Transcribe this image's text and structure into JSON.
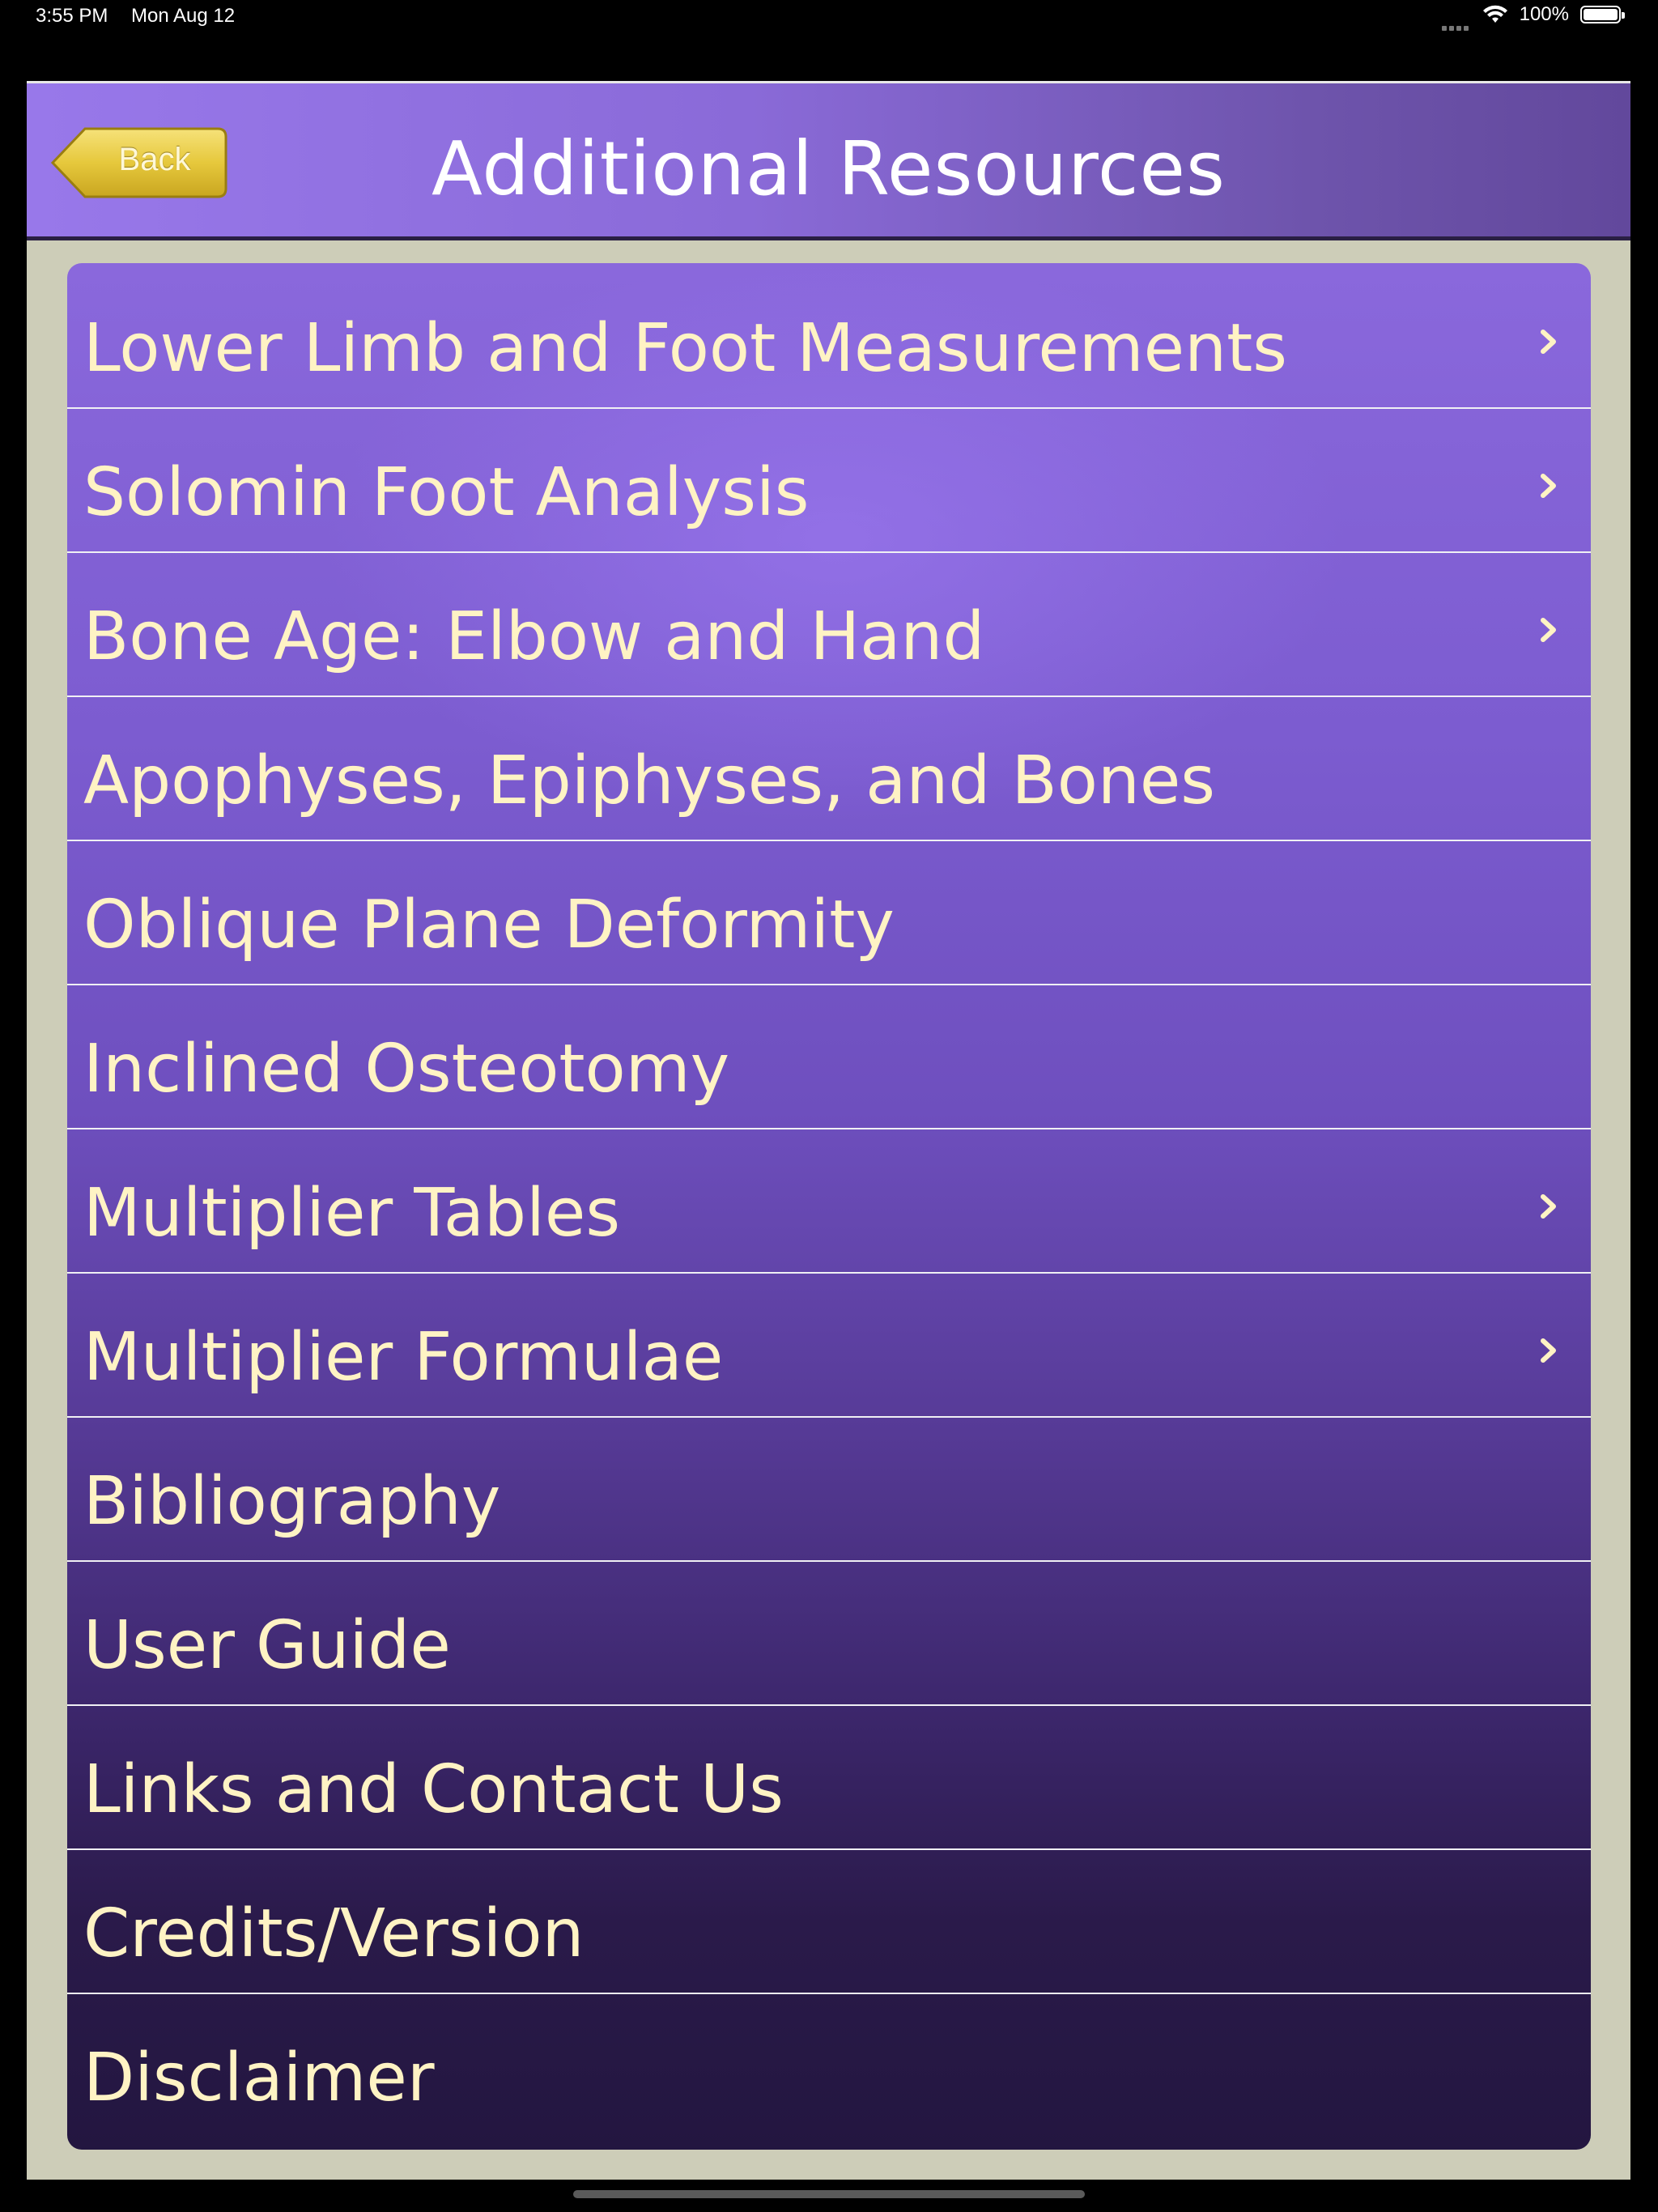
{
  "status_bar": {
    "time": "3:55 PM",
    "date": "Mon Aug 12",
    "battery": "100%"
  },
  "header": {
    "title": "Additional Resources",
    "back_label": "Back"
  },
  "menu": {
    "items": [
      {
        "label": "Lower Limb and Foot Measurements",
        "has_chevron": true
      },
      {
        "label": "Solomin Foot Analysis",
        "has_chevron": true
      },
      {
        "label": "Bone Age: Elbow and Hand",
        "has_chevron": true
      },
      {
        "label": "Apophyses, Epiphyses, and Bones",
        "has_chevron": false
      },
      {
        "label": "Oblique Plane Deformity",
        "has_chevron": false
      },
      {
        "label": "Inclined Osteotomy",
        "has_chevron": false
      },
      {
        "label": "Multiplier Tables",
        "has_chevron": true
      },
      {
        "label": "Multiplier Formulae",
        "has_chevron": true
      },
      {
        "label": "Bibliography",
        "has_chevron": false
      },
      {
        "label": "User Guide",
        "has_chevron": false
      },
      {
        "label": "Links and Contact Us",
        "has_chevron": false
      },
      {
        "label": "Credits/Version",
        "has_chevron": false
      },
      {
        "label": "Disclaimer",
        "has_chevron": false
      }
    ]
  },
  "colors": {
    "header_start": "#9878ea",
    "header_end": "#62489c",
    "item_text": "#fff3c4",
    "frame_bg": "#cdcdb8",
    "back_button": "#e8c840"
  },
  "icons": {
    "chevron": "chevron-right-icon",
    "wifi": "wifi-icon",
    "battery": "battery-icon"
  }
}
